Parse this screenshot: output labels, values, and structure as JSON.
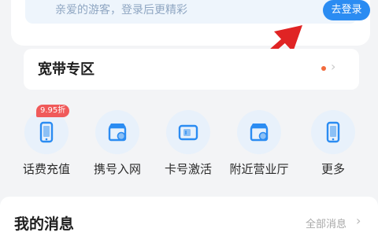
{
  "login": {
    "hint": "亲爱的游客，登录后更精彩",
    "button": "去登录"
  },
  "broadband": {
    "title": "宽带专区",
    "chevron": "›"
  },
  "services": [
    {
      "label": "话费充值",
      "icon": "phone-recharge-icon",
      "badge": "9.95折"
    },
    {
      "label": "携号入网",
      "icon": "store-transfer-icon"
    },
    {
      "label": "卡号激活",
      "icon": "sim-card-activate-icon"
    },
    {
      "label": "附近营业厅",
      "icon": "nearby-store-icon"
    },
    {
      "label": "更多",
      "icon": "more-phone-icon"
    }
  ],
  "messages": {
    "title": "我的消息",
    "all_label": "全部消息",
    "chevron": "›"
  },
  "colors": {
    "accent": "#2b8cf2",
    "badge": "#f05a5a",
    "annotation_arrow": "#e02424",
    "icon_bg": "#e8f1fb"
  }
}
